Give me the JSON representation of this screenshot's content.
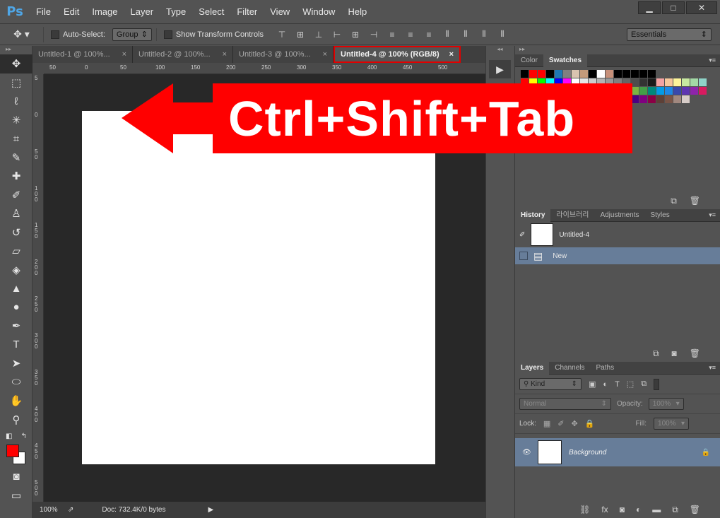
{
  "app": {
    "logo": "Ps"
  },
  "menu": [
    "File",
    "Edit",
    "Image",
    "Layer",
    "Type",
    "Select",
    "Filter",
    "View",
    "Window",
    "Help"
  ],
  "window_controls": {
    "minimize": "▁",
    "maximize": "□",
    "close": "✕"
  },
  "options": {
    "auto_select_label": "Auto-Select:",
    "auto_select_value": "Group",
    "transform_label": "Show Transform Controls",
    "workspace": "Essentials"
  },
  "tabs": [
    {
      "label": "Untitled-1 @ 100%...",
      "close": "×"
    },
    {
      "label": "Untitled-2 @ 100%...",
      "close": "×"
    },
    {
      "label": "Untitled-3 @ 100%...",
      "close": "×"
    },
    {
      "label": "Untitled-4 @ 100% (RGB/8)",
      "close": "×"
    }
  ],
  "ruler_top": [
    "50",
    "0",
    "50",
    "100",
    "150",
    "200",
    "250",
    "300",
    "350",
    "400",
    "450",
    "500"
  ],
  "ruler_left": [
    "5",
    "0",
    "5\n0",
    "1\n0\n0",
    "1\n5\n0",
    "2\n0\n0",
    "2\n5\n0",
    "3\n0\n0",
    "3\n5\n0",
    "4\n0\n0",
    "4\n5\n0",
    "5\n0\n0"
  ],
  "status": {
    "zoom": "100%",
    "doc": "Doc: 732.4K/0 bytes"
  },
  "overlay": {
    "text": "Ctrl+Shift+Tab"
  },
  "swatches_panel": {
    "tab1": "Color",
    "tab2": "Swatches"
  },
  "history_panel": {
    "tabs": [
      "History",
      "라이브러리",
      "Adjustments",
      "Styles"
    ],
    "snapshot": "Untitled-4",
    "step": "New"
  },
  "layers_panel": {
    "tabs": [
      "Layers",
      "Channels",
      "Paths"
    ],
    "filter": "Kind",
    "blend_mode": "Normal",
    "opacity_label": "Opacity:",
    "opacity_value": "100%",
    "lock_label": "Lock:",
    "fill_label": "Fill:",
    "fill_value": "100%",
    "layer_name": "Background"
  },
  "colors": {
    "foreground": "#ff0000",
    "background": "#ffffff",
    "highlight": "#e10000",
    "selection": "#677d99"
  }
}
